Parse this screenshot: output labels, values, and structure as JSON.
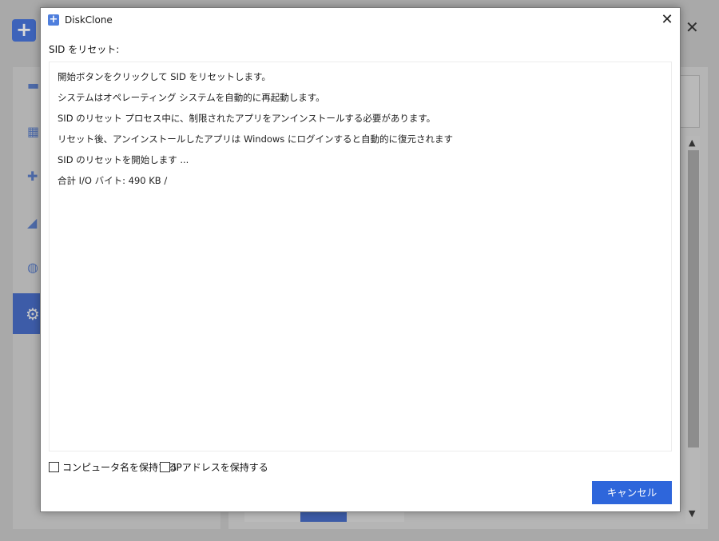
{
  "dialog": {
    "title": "DiskClone",
    "section_title": "SID をリセット:",
    "log_lines": [
      "開始ボタンをクリックして SID をリセットします。",
      "システムはオペレーティング システムを自動的に再起動します。",
      "SID のリセット プロセス中に、制限されたアプリをアンインストールする必要があります。",
      "リセット後、アンインストールしたアプリは Windows にログインすると自動的に復元されます",
      "SID のリセットを開始します ...",
      "合計 I/O バイト: 490 KB  /"
    ],
    "options": [
      {
        "label": "コンピュータ名を保持する",
        "checked": false
      },
      {
        "label": "IPアドレスを保持する",
        "checked": false
      }
    ],
    "cancel_label": "キャンセル",
    "close_glyph": "✕"
  },
  "background": {
    "close_glyph": "✕",
    "logo_glyph": "+"
  },
  "colors": {
    "accent": "#2e66db",
    "title_icon": "#4f7fdd",
    "background_overlay": "#a9a9a9"
  }
}
